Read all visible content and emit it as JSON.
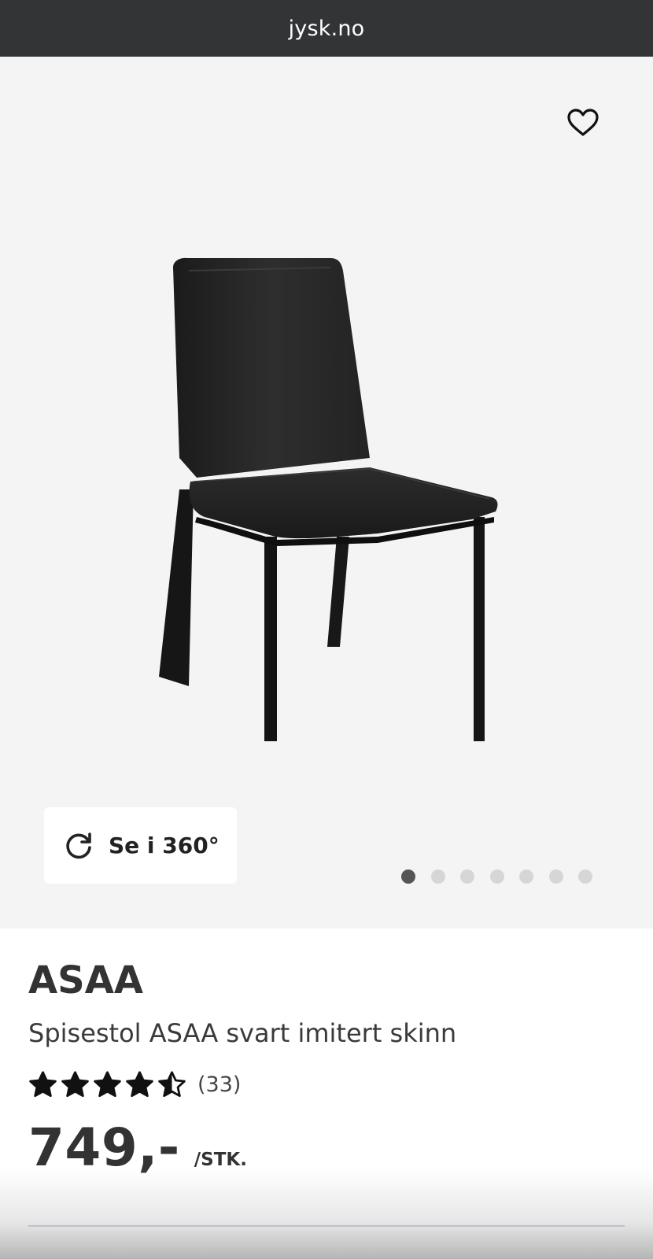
{
  "browser": {
    "url": "jysk.no"
  },
  "gallery": {
    "view360_label": "Se i 360°",
    "image_count": 7,
    "active_index": 0,
    "icons": {
      "favorite": "heart-outline-icon",
      "rotate": "rotate-360-icon"
    }
  },
  "product": {
    "brand": "ASAA",
    "name": "Spisestol ASAA svart imitert skinn",
    "rating": 4.5,
    "review_count": "(33)",
    "price": "749,-",
    "price_unit": "/STK."
  },
  "colors": {
    "topbar": "#333435",
    "background": "#f4f4f4",
    "text": "#333333",
    "dot_active": "#555555",
    "dot_inactive": "#d6d6d6"
  }
}
